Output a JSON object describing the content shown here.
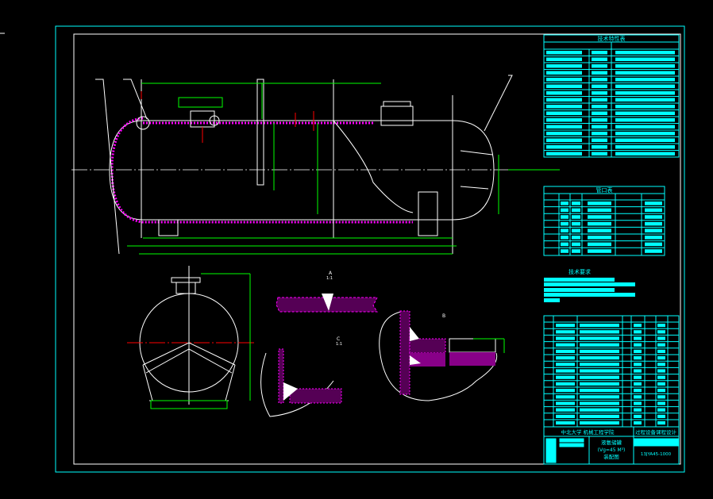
{
  "colors": {
    "background": "#000000",
    "frame": "#00ffff",
    "outline": "#ffffff",
    "dimension": "#00ff00",
    "centerline": "#ff0000",
    "hatch": "#ff00ff",
    "table": "#00ffff"
  },
  "tables": {
    "spec_title": "技术特性表",
    "nozzle_title": "管口表",
    "requirements_title": "技术要求"
  },
  "details": {
    "a_label": "A",
    "a_scale": "1:1",
    "c_label": "C",
    "c_scale": "1:1",
    "b_label": "B"
  },
  "title_block": {
    "school": "中北大学  机械工程学院",
    "course": "过程设备课程设计",
    "name": "液氨储罐",
    "spec": "(Vg=45 M³)",
    "drawing_type": "装配图",
    "drawing_no": "13JYA45-1000"
  }
}
